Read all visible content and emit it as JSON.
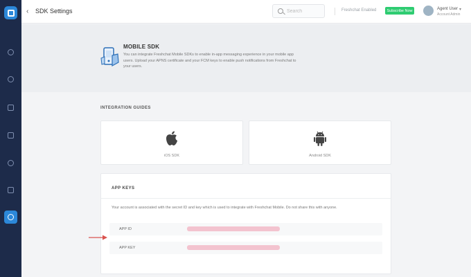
{
  "header": {
    "title": "SDK Settings",
    "search_placeholder": "Search",
    "link_text": "Freshchat Enabled",
    "status_badge": "Subscribe Now",
    "user_name": "Agent User",
    "user_role": "Account Admin"
  },
  "sidebar": {
    "items": [
      "dashboard-icon",
      "contacts-icon",
      "campaigns-icon",
      "reports-icon",
      "team-icon",
      "files-icon",
      "settings-icon"
    ],
    "active_item": "settings-icon"
  },
  "banner": {
    "title": "MOBILE SDK",
    "description": "You can integrate Freshchat Mobile SDKs to enable in-app messaging experience in your mobile app users. Upload your APNS certificate and your FCM keys to enable push notifications from Freshchat to your users."
  },
  "integration": {
    "section_title": "INTEGRATION GUIDES",
    "guides": [
      {
        "label": "iOS SDK",
        "icon": "apple-icon"
      },
      {
        "label": "Android SDK",
        "icon": "android-icon"
      }
    ]
  },
  "app_keys": {
    "title": "APP KEYS",
    "description": "Your account is associated with the secret ID and key which is used to integrate with Freshchat Mobile. Do not share this with anyone.",
    "rows": [
      {
        "label": "APP ID"
      },
      {
        "label": "APP KEY"
      }
    ]
  },
  "colors": {
    "sidebar": "#1d2b4a",
    "accent": "#2c88d9",
    "badge": "#2ecc71",
    "redacted": "#f3c3cf",
    "annotation": "#d9534f"
  }
}
